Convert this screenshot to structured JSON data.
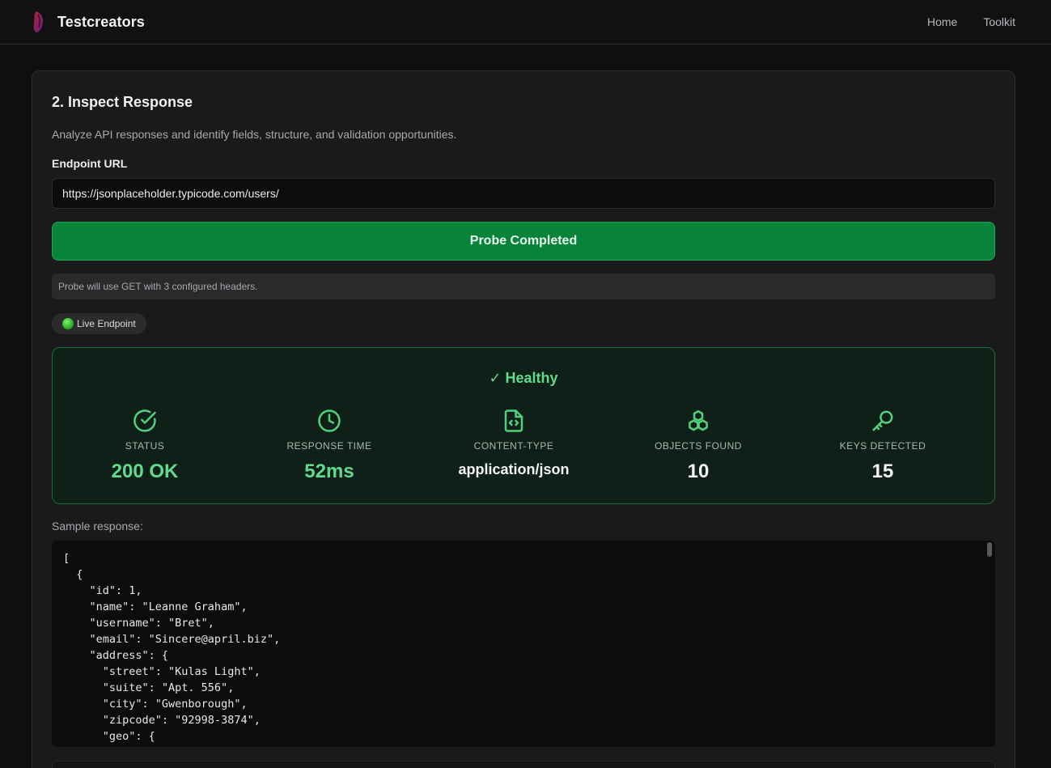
{
  "header": {
    "brand": "Testcreators",
    "nav": [
      "Home",
      "Toolkit"
    ]
  },
  "section": {
    "title": "2. Inspect Response",
    "description": "Analyze API responses and identify fields, structure, and validation opportunities.",
    "endpoint_label": "Endpoint URL",
    "endpoint_value": "https://jsonplaceholder.typicode.com/users/",
    "probe_button": "Probe Completed",
    "hint": "Probe will use GET with 3 configured headers.",
    "live_badge": "Live Endpoint"
  },
  "health": {
    "title": "✓ Healthy",
    "metrics": [
      {
        "label": "STATUS",
        "value": "200 OK",
        "icon": "check-circle-icon"
      },
      {
        "label": "RESPONSE TIME",
        "value": "52ms",
        "icon": "clock-icon"
      },
      {
        "label": "CONTENT-TYPE",
        "value": "application/json",
        "icon": "file-code-icon"
      },
      {
        "label": "OBJECTS FOUND",
        "value": "10",
        "icon": "cubes-icon"
      },
      {
        "label": "KEYS DETECTED",
        "value": "15",
        "icon": "key-icon"
      }
    ]
  },
  "sample": {
    "label": "Sample response:",
    "code": "[\n  {\n    \"id\": 1,\n    \"name\": \"Leanne Graham\",\n    \"username\": \"Bret\",\n    \"email\": \"Sincere@april.biz\",\n    \"address\": {\n      \"street\": \"Kulas Light\",\n      \"suite\": \"Apt. 556\",\n      \"city\": \"Gwenborough\",\n      \"zipcode\": \"92998-3874\",\n      \"geo\": {"
  },
  "colors": {
    "accent_green": "#62d98c",
    "button_green": "#08843a",
    "background": "#0f0f10",
    "card": "#1a1a1c"
  }
}
